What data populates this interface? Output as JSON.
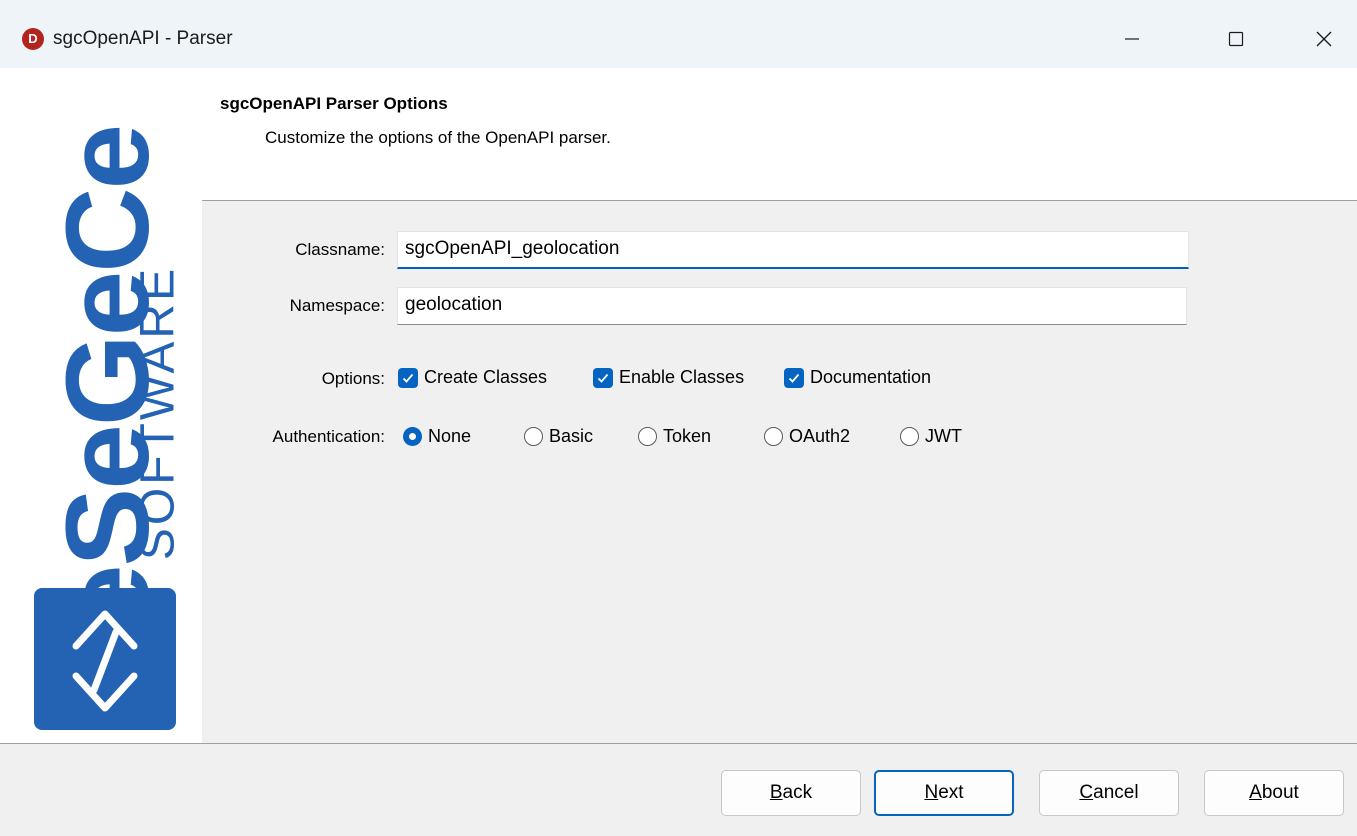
{
  "window": {
    "title": "sgcOpenAPI - Parser",
    "app_icon_letter": "D"
  },
  "logo": {
    "brand": "eSeGeCe",
    "sub": "SOFTWARE",
    "color": "#2463b4"
  },
  "header": {
    "title": "sgcOpenAPI Parser Options",
    "subtitle": "Customize the options of the OpenAPI parser."
  },
  "form": {
    "classname_label": "Classname:",
    "classname_value": "sgcOpenAPI_geolocation",
    "namespace_label": "Namespace:",
    "namespace_value": "geolocation",
    "options_label": "Options:",
    "options": [
      {
        "label": "Create Classes",
        "checked": true
      },
      {
        "label": "Enable Classes",
        "checked": true
      },
      {
        "label": "Documentation",
        "checked": true
      }
    ],
    "auth_label": "Authentication:",
    "auth_options": [
      {
        "label": "None",
        "selected": true
      },
      {
        "label": "Basic",
        "selected": false
      },
      {
        "label": "Token",
        "selected": false
      },
      {
        "label": "OAuth2",
        "selected": false
      },
      {
        "label": "JWT",
        "selected": false
      }
    ]
  },
  "buttons": {
    "back": {
      "first": "B",
      "rest": "ack"
    },
    "next": {
      "first": "N",
      "rest": "ext"
    },
    "cancel": {
      "first": "C",
      "rest": "ancel"
    },
    "about": {
      "first": "A",
      "rest": "bout"
    }
  },
  "colors": {
    "accent": "#0563c1",
    "titlebar": "#eff4f9"
  }
}
